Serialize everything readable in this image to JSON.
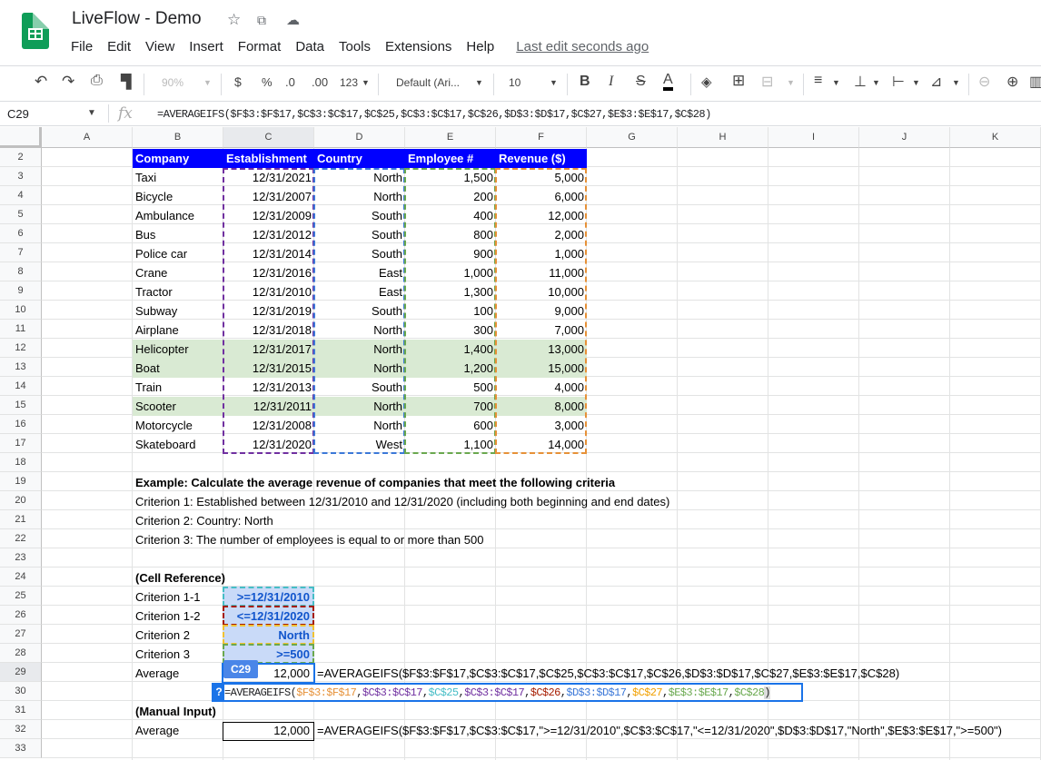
{
  "title_bar": {
    "doc_title": "LiveFlow - Demo",
    "menu": [
      "File",
      "Edit",
      "View",
      "Insert",
      "Format",
      "Data",
      "Tools",
      "Extensions",
      "Help"
    ],
    "last_edit": "Last edit seconds ago"
  },
  "toolbar": {
    "zoom": "90%",
    "currency": "$",
    "percent": "%",
    "dec_less": ".0",
    "dec_more": ".00",
    "number_format": "123",
    "font": "Default (Ari...",
    "font_size": "10",
    "bold": "B",
    "italic": "I",
    "strike": "S",
    "text_color": "A"
  },
  "formula_bar": {
    "cell_ref": "C29",
    "fx": "fx",
    "formula": "=AVERAGEIFS($F$3:$F$17,$C$3:$C$17,$C$25,$C$3:$C$17,$C$26,$D$3:$D$17,$C$27,$E$3:$E$17,$C$28)"
  },
  "columns": [
    "A",
    "B",
    "C",
    "D",
    "E",
    "F",
    "G",
    "H",
    "I",
    "J",
    "K"
  ],
  "rows": [
    "2",
    "3",
    "4",
    "5",
    "6",
    "7",
    "8",
    "9",
    "10",
    "11",
    "12",
    "13",
    "14",
    "15",
    "16",
    "17",
    "18",
    "19",
    "20",
    "21",
    "22",
    "23",
    "24",
    "25",
    "26",
    "27",
    "28",
    "29",
    "30",
    "31",
    "32",
    "33"
  ],
  "table": {
    "headers": [
      "Company",
      "Establishment",
      "Country",
      "Employee #",
      "Revenue ($)"
    ],
    "rows": [
      [
        "Taxi",
        "12/31/2021",
        "North",
        "1,500",
        "5,000"
      ],
      [
        "Bicycle",
        "12/31/2007",
        "North",
        "200",
        "6,000"
      ],
      [
        "Ambulance",
        "12/31/2009",
        "South",
        "400",
        "12,000"
      ],
      [
        "Bus",
        "12/31/2012",
        "South",
        "800",
        "2,000"
      ],
      [
        "Police car",
        "12/31/2014",
        "South",
        "900",
        "1,000"
      ],
      [
        "Crane",
        "12/31/2016",
        "East",
        "1,000",
        "11,000"
      ],
      [
        "Tractor",
        "12/31/2010",
        "East",
        "1,300",
        "10,000"
      ],
      [
        "Subway",
        "12/31/2019",
        "South",
        "100",
        "9,000"
      ],
      [
        "Airplane",
        "12/31/2018",
        "North",
        "300",
        "7,000"
      ],
      [
        "Helicopter",
        "12/31/2017",
        "North",
        "1,400",
        "13,000"
      ],
      [
        "Boat",
        "12/31/2015",
        "North",
        "1,200",
        "15,000"
      ],
      [
        "Train",
        "12/31/2013",
        "South",
        "500",
        "4,000"
      ],
      [
        "Scooter",
        "12/31/2011",
        "North",
        "700",
        "8,000"
      ],
      [
        "Motorcycle",
        "12/31/2008",
        "North",
        "600",
        "3,000"
      ],
      [
        "Skateboard",
        "12/31/2020",
        "West",
        "1,100",
        "14,000"
      ]
    ]
  },
  "example": {
    "heading": "Example: Calculate the average revenue of companies that meet the following criteria",
    "c1": "Criterion 1: Established between 12/31/2010 and 12/31/2020 (including both beginning and end dates)",
    "c2": "Criterion 2: Country: North",
    "c3": "Criterion 3: The number of employees is equal to or more than 500"
  },
  "cell_ref_section": {
    "heading": "(Cell Reference)",
    "labels": [
      "Criterion 1-1",
      "Criterion 1-2",
      "Criterion 2",
      "Criterion 3",
      "Average"
    ],
    "values": [
      ">=12/31/2010",
      "<=12/31/2020",
      "North",
      ">=500"
    ],
    "average": "12,000",
    "formula": "=AVERAGEIFS($F$3:$F$17,$C$3:$C$17,$C$25,$C$3:$C$17,$C$26,$D$3:$D$17,$C$27,$E$3:$E$17,$C$28)",
    "active_cell_label": "C29",
    "edit_hint": "?",
    "edit_parts": [
      "=AVERAGEIFS(",
      "$F$3:$F$17",
      ",",
      "$C$3:$C$17",
      ",",
      "$C$25",
      ",",
      "$C$3:$C$17",
      ",",
      "$C$26",
      ",",
      "$D$3:$D$17",
      ",",
      "$C$27",
      ",",
      "$E$3:$E$17",
      ",",
      "$C$28",
      ")"
    ]
  },
  "manual_section": {
    "heading": "(Manual Input)",
    "label": "Average",
    "average": "12,000",
    "formula": "=AVERAGEIFS($F$3:$F$17,$C$3:$C$17,\">=12/31/2010\",$C$3:$C$17,\"<=12/31/2020\",$D$3:$D$17,\"North\",$E$3:$E$17,\">=500\")"
  },
  "colors": {
    "header_blue": "#0000ff",
    "green_highlight": "#d9ead3",
    "purple": "#7030a0",
    "blue": "#3c78d8",
    "green": "#6aa84f",
    "orange": "#e69138",
    "teal": "#46bdc6",
    "brown": "#a61c00"
  }
}
